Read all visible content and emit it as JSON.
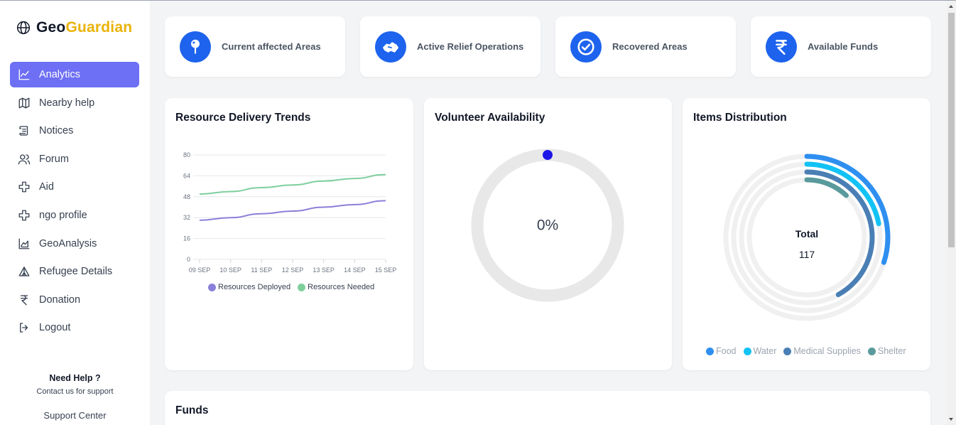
{
  "brand": {
    "name_main": "Geo",
    "name_accent": "Guardian",
    "accent_color": "#eab308"
  },
  "sidebar": {
    "items": [
      {
        "label": "Analytics",
        "icon": "chart-line-icon",
        "active": true
      },
      {
        "label": "Nearby help",
        "icon": "map-icon"
      },
      {
        "label": "Notices",
        "icon": "scroll-icon"
      },
      {
        "label": "Forum",
        "icon": "users-icon"
      },
      {
        "label": "Aid",
        "icon": "plus-outline-icon"
      },
      {
        "label": "ngo profile",
        "icon": "plus-outline-icon"
      },
      {
        "label": "GeoAnalysis",
        "icon": "area-chart-icon"
      },
      {
        "label": "Refugee Details",
        "icon": "tent-icon"
      },
      {
        "label": "Donation",
        "icon": "rupee-icon"
      },
      {
        "label": "Logout",
        "icon": "logout-icon"
      }
    ],
    "help_title": "Need Help ?",
    "help_sub": "Contact us for support",
    "help_link": "Support Center"
  },
  "stats": [
    {
      "label": "Current affected Areas",
      "icon": "pin-icon"
    },
    {
      "label": "Active Relief Operations",
      "icon": "handshake-icon"
    },
    {
      "label": "Recovered Areas",
      "icon": "check-circle-icon"
    },
    {
      "label": "Available Funds",
      "icon": "rupee-icon"
    }
  ],
  "panels": {
    "delivery": {
      "title": "Resource Delivery Trends"
    },
    "volunteer": {
      "title": "Volunteer Availability",
      "value_text": "0%"
    },
    "items": {
      "title": "Items Distribution",
      "total_label": "Total",
      "total_value": "117"
    },
    "funds": {
      "title": "Funds"
    }
  },
  "chart_data": [
    {
      "type": "line",
      "title": "Resource Delivery Trends",
      "x": [
        "09 SEP",
        "10 SEP",
        "11 SEP",
        "12 SEP",
        "13 SEP",
        "14 SEP",
        "15 SEP"
      ],
      "yticks": [
        0,
        16,
        32,
        48,
        64,
        80
      ],
      "ylim": [
        0,
        80
      ],
      "series": [
        {
          "name": "Resources Deployed",
          "color": "#8b80d9",
          "values": [
            30,
            32,
            35,
            37,
            40,
            42,
            45
          ]
        },
        {
          "name": "Resources Needed",
          "color": "#7fcf9d",
          "values": [
            50,
            52,
            55,
            57,
            60,
            62,
            65
          ]
        }
      ],
      "legend": "bottom"
    },
    {
      "type": "radial",
      "title": "Volunteer Availability",
      "value_percent": 0,
      "color": "#1d16e8"
    },
    {
      "type": "radial-bar",
      "title": "Items Distribution",
      "total": 117,
      "series": [
        {
          "name": "Food",
          "color": "#2e8ff0",
          "fraction": 0.3
        },
        {
          "name": "Water",
          "color": "#13c2f5",
          "fraction": 0.22
        },
        {
          "name": "Medical Supplies",
          "color": "#4a7fb5",
          "fraction": 0.42
        },
        {
          "name": "Shelter",
          "color": "#5a9a9c",
          "fraction": 0.12
        }
      ],
      "legend": "bottom"
    }
  ]
}
